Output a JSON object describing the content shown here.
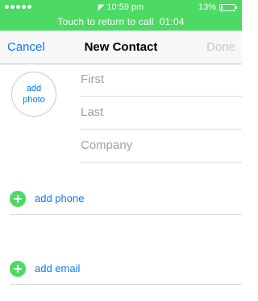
{
  "status_bar": {
    "time": "10:59 pm",
    "battery_percent": "13%",
    "signal_dots": 5
  },
  "call_banner": {
    "text": "Touch to return to call",
    "duration": "01:04",
    "color": "#4cd964"
  },
  "nav": {
    "cancel_label": "Cancel",
    "title": "New Contact",
    "done_label": "Done"
  },
  "photo": {
    "label_line1": "add",
    "label_line2": "photo"
  },
  "name_fields": {
    "first_placeholder": "First",
    "last_placeholder": "Last",
    "company_placeholder": "Company"
  },
  "actions": {
    "add_phone_label": "add phone",
    "add_email_label": "add email"
  },
  "colors": {
    "accent": "#007aff",
    "add_icon": "#4cd964",
    "disabled": "#c7c7cc"
  }
}
